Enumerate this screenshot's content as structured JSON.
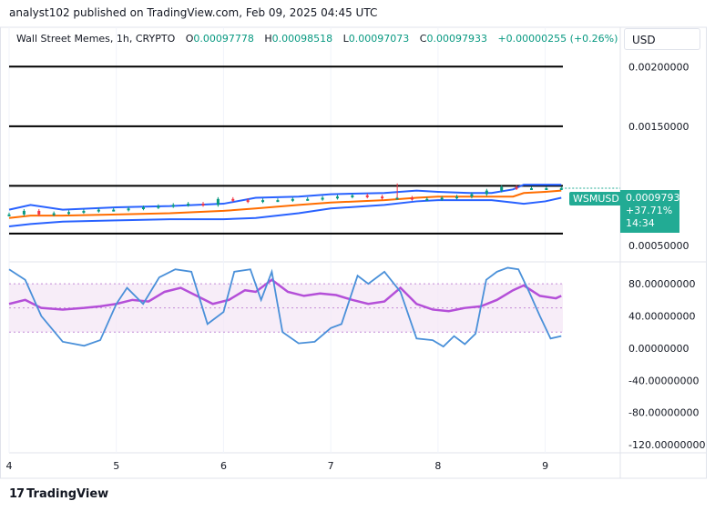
{
  "header": {
    "publisher_line": "analyst102 published on TradingView.com, Feb 09, 2025 04:45 UTC"
  },
  "legend": {
    "symbol": "Wall Street Memes, 1h, CRYPTO",
    "o_label": "O",
    "o_value": "0.00097778",
    "h_label": "H",
    "h_value": "0.00098518",
    "l_label": "L",
    "l_value": "0.00097073",
    "c_label": "C",
    "c_value": "0.00097933",
    "change": "+0.00000255 (+0.26%)"
  },
  "currency_button": "USD",
  "price_tag": {
    "symbol": "WSMUSD",
    "price": "0.00097933",
    "change_pct": "+37.71%",
    "countdown": "14:34"
  },
  "brand": {
    "logo": "17",
    "name": "TradingView"
  },
  "colors": {
    "up": "#089981",
    "down": "#f23645",
    "bb_band": "#2962ff",
    "bb_basis": "#ff6d00",
    "stoch_k": "#4a90d9",
    "stoch_d": "#b44fd8",
    "band_fill": "#f3e5f5",
    "tag": "#22ab94"
  },
  "chart_data": [
    {
      "type": "line",
      "name": "price-pane",
      "x_ticks": [
        "4",
        "5",
        "6",
        "7",
        "8",
        "9"
      ],
      "x_range": [
        4.0,
        9.7
      ],
      "y_ticks": [
        "0.00200000",
        "0.00150000",
        "0.00050000"
      ],
      "y_range": [
        0.00037,
        0.00233
      ],
      "horizontal_levels": [
        0.002,
        0.0015,
        0.001,
        0.0006
      ],
      "bollinger": {
        "x": [
          4.0,
          4.2,
          4.5,
          5.0,
          5.5,
          6.0,
          6.3,
          6.7,
          7.0,
          7.5,
          7.8,
          8.0,
          8.3,
          8.5,
          8.7,
          8.8,
          9.0,
          9.15
        ],
        "upper": [
          0.0008,
          0.00084,
          0.0008,
          0.00082,
          0.00083,
          0.00085,
          0.0009,
          0.00091,
          0.00093,
          0.00094,
          0.00096,
          0.00095,
          0.00094,
          0.00094,
          0.00097,
          0.00101,
          0.00101,
          0.00101
        ],
        "basis": [
          0.00073,
          0.00075,
          0.00075,
          0.00076,
          0.00077,
          0.00079,
          0.00081,
          0.00084,
          0.00086,
          0.00088,
          0.0009,
          0.00091,
          0.00091,
          0.00091,
          0.00091,
          0.00094,
          0.00095,
          0.00096
        ],
        "lower": [
          0.00066,
          0.00068,
          0.0007,
          0.00071,
          0.00072,
          0.00072,
          0.00073,
          0.00077,
          0.00081,
          0.00084,
          0.00087,
          0.00088,
          0.00088,
          0.00088,
          0.00086,
          0.00085,
          0.00087,
          0.0009
        ]
      },
      "close": [
        0.00076,
        0.00079,
        0.00076,
        0.00077,
        0.00078,
        0.00079,
        0.0008,
        0.0008,
        0.00081,
        0.00082,
        0.00083,
        0.00084,
        0.00085,
        0.00084,
        0.00089,
        0.00088,
        0.00087,
        0.00088,
        0.00088,
        0.00089,
        0.00089,
        0.0009,
        0.00091,
        0.00092,
        0.00091,
        0.0009,
        0.0009,
        0.00089,
        0.00089,
        0.0009,
        0.00091,
        0.00093,
        0.00096,
        0.00099,
        0.00098,
        0.00098,
        0.00098,
        0.00098
      ],
      "wick_high": 0.00102,
      "wick_high_x": 7.62
    },
    {
      "type": "line",
      "name": "stochastic-pane",
      "x_range": [
        4.0,
        9.7
      ],
      "y_ticks": [
        "80.00000000",
        "40.00000000",
        "0.00000000",
        "-40.00000000",
        "-80.00000000",
        "-120.00000000"
      ],
      "y_range": [
        -130,
        105
      ],
      "band": [
        20,
        80
      ],
      "midline": 50,
      "k": {
        "x": [
          4.0,
          4.15,
          4.3,
          4.5,
          4.7,
          4.85,
          5.0,
          5.1,
          5.25,
          5.4,
          5.55,
          5.7,
          5.85,
          6.0,
          6.1,
          6.25,
          6.35,
          6.45,
          6.55,
          6.7,
          6.85,
          7.0,
          7.1,
          7.25,
          7.35,
          7.5,
          7.65,
          7.8,
          7.95,
          8.05,
          8.15,
          8.25,
          8.35,
          8.45,
          8.55,
          8.65,
          8.75,
          8.85,
          8.95,
          9.05,
          9.15
        ],
        "v": [
          98,
          85,
          40,
          8,
          3,
          10,
          55,
          75,
          55,
          88,
          98,
          95,
          30,
          45,
          95,
          98,
          60,
          95,
          20,
          6,
          8,
          25,
          30,
          90,
          80,
          95,
          70,
          12,
          10,
          2,
          15,
          5,
          18,
          85,
          95,
          100,
          98,
          70,
          40,
          12,
          15
        ]
      },
      "d": {
        "x": [
          4.0,
          4.15,
          4.3,
          4.5,
          4.7,
          4.85,
          5.0,
          5.15,
          5.3,
          5.45,
          5.6,
          5.75,
          5.9,
          6.05,
          6.2,
          6.3,
          6.45,
          6.6,
          6.75,
          6.9,
          7.05,
          7.2,
          7.35,
          7.5,
          7.65,
          7.8,
          7.95,
          8.1,
          8.25,
          8.4,
          8.55,
          8.7,
          8.8,
          8.95,
          9.1,
          9.15
        ],
        "v": [
          55,
          60,
          50,
          48,
          50,
          52,
          55,
          60,
          58,
          70,
          75,
          65,
          55,
          60,
          72,
          70,
          85,
          70,
          65,
          68,
          66,
          60,
          55,
          58,
          75,
          55,
          48,
          46,
          50,
          52,
          60,
          72,
          78,
          65,
          62,
          65
        ]
      }
    }
  ]
}
